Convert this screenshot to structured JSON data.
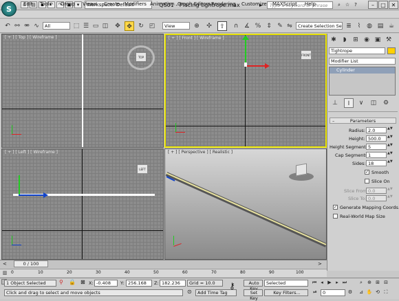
{
  "title_bar": {
    "workspace": "Workspace: Default",
    "window_title": "QS01 - Placing tightrope.max",
    "search_placeholder": "Type a keyword or phrase",
    "minimize": "–",
    "maximize": "□",
    "close": "✕"
  },
  "menu": [
    "Edit",
    "Tools",
    "Group",
    "Views",
    "Create",
    "Modifiers",
    "Animation",
    "Graph Editors",
    "Rendering",
    "Customize",
    "MAXScript",
    "Help"
  ],
  "toolbar": {
    "filter": "All",
    "coord_system": "View",
    "selection_set": "Create Selection Se"
  },
  "viewports": {
    "top": {
      "label": "[ + ] [ Top ] [ Wireframe ]",
      "cube": "TOP"
    },
    "front": {
      "label": "[ + ] [ Front ] [ Wireframe ]",
      "cube": "FRONT"
    },
    "left": {
      "label": "[ + ] [ Left ] [ Wireframe ]",
      "cube": "LEFT"
    },
    "perspective": {
      "label": "[ + ] [ Perspective ] [ Realistic ]"
    }
  },
  "command_panel": {
    "object_name": "Tightrope",
    "object_color": "#ffd000",
    "modifier_list": "Modifier List",
    "stack_item": "Cylinder",
    "rollout_title": "Parameters",
    "params": [
      {
        "label": "Radius:",
        "value": "2.0"
      },
      {
        "label": "Height:",
        "value": "500.0"
      },
      {
        "label": "Height Segments:",
        "value": "5"
      },
      {
        "label": "Cap Segments:",
        "value": "1"
      },
      {
        "label": "Sides:",
        "value": "18"
      }
    ],
    "smooth": "Smooth",
    "slice_on": "Slice On",
    "slice_from": {
      "label": "Slice From:",
      "value": "0.0"
    },
    "slice_to": {
      "label": "Slice To:",
      "value": "0.0"
    },
    "gen_mapping": "Generate Mapping Coords.",
    "real_world": "Real-World Map Size"
  },
  "timeline": {
    "frame": "0 / 100",
    "ticks": [
      "0",
      "10",
      "20",
      "30",
      "40",
      "50",
      "60",
      "70",
      "80",
      "90",
      "100"
    ]
  },
  "status": {
    "selection": "1 Object Selected",
    "prompt": "Click and drag to select and move objects",
    "x_label": "X:",
    "x": "-0.408",
    "y_label": "Y:",
    "y": "256.168",
    "z_label": "Z:",
    "z": "182.236",
    "grid": "Grid = 10.0",
    "add_time_tag": "Add Time Tag",
    "auto_key": "Auto Key",
    "set_key": "Set Key",
    "selected": "Selected",
    "key_filters": "Key Filters...",
    "frame_value": "0"
  },
  "colors": {
    "accent_active": "#ffd84a",
    "viewport_bg": "#8c8c8c",
    "active_border": "#e6e000"
  }
}
